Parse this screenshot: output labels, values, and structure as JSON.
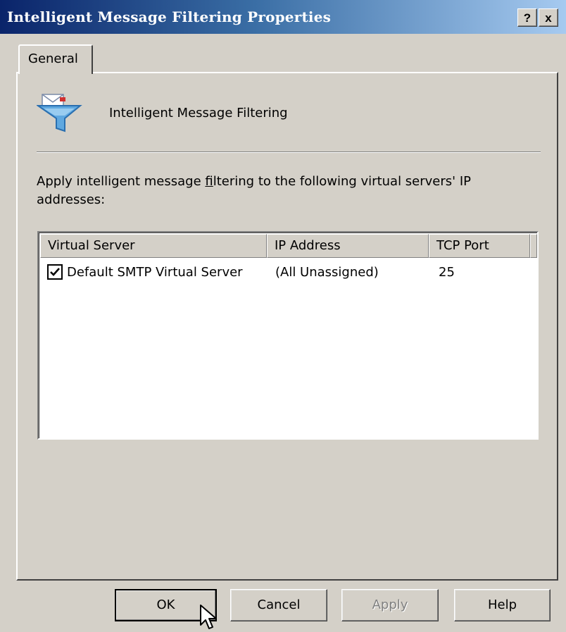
{
  "window": {
    "title": "Intelligent Message Filtering Properties",
    "help_glyph": "?",
    "close_glyph": "x"
  },
  "tabs": [
    {
      "label": "General",
      "selected": true
    }
  ],
  "general": {
    "heading": "Intelligent Message Filtering",
    "description_before": "Apply intelligent message ",
    "description_underlined": "f",
    "description_after": "iltering to the following virtual servers' IP addresses:"
  },
  "server_list": {
    "columns": [
      "Virtual Server",
      "IP Address",
      "TCP Port"
    ],
    "rows": [
      {
        "checked": true,
        "virtual_server": "Default SMTP Virtual Server",
        "ip_address": "(All Unassigned)",
        "tcp_port": "25"
      }
    ]
  },
  "buttons": {
    "ok": "OK",
    "cancel": "Cancel",
    "apply": "Apply",
    "help": "Help"
  },
  "icons": {
    "header_icon": "funnel-mail-icon",
    "checkbox_icon": "checkmark-icon",
    "pointer_icon": "mouse-pointer-icon"
  },
  "colors": {
    "title_gradient_start": "#0a246a",
    "title_gradient_end": "#a6caf0",
    "dialog_face": "#d4d0c8"
  }
}
